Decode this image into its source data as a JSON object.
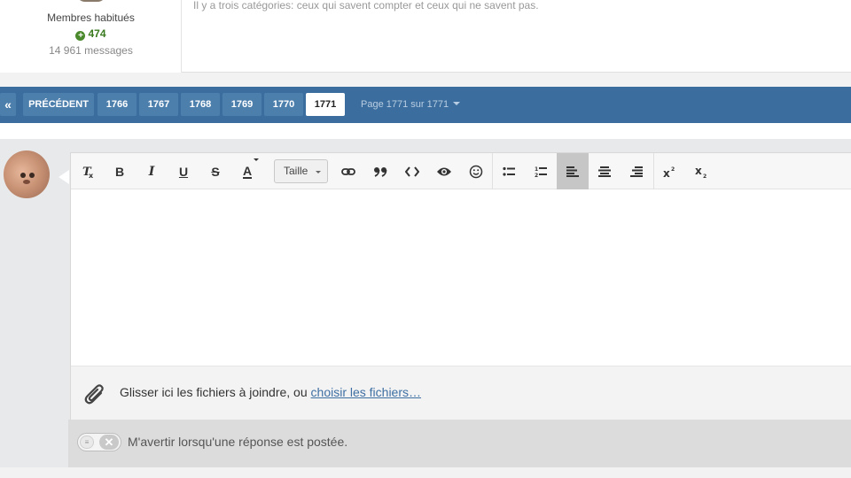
{
  "post": {
    "author_group": "Membres habitués",
    "reputation": "474",
    "messages": "14 961 messages",
    "signature": "Il y a trois catégories: ceux qui savent compter et ceux qui ne savent pas."
  },
  "pagination": {
    "first_icon": "double-chevron-left-icon",
    "first_glyph": "«",
    "prev_label": "PRÉCÉDENT",
    "pages": [
      "1766",
      "1767",
      "1768",
      "1769",
      "1770",
      "1771"
    ],
    "current_page": "1771",
    "page_info": "Page 1771 sur 1771"
  },
  "editor": {
    "toolbar": {
      "clear_format": "remove-format-icon",
      "bold": "B",
      "italic": "I",
      "underline": "U",
      "strike": "S",
      "color": "A",
      "size_label": "Taille",
      "link": "link-icon",
      "quote": "quote-icon",
      "code": "code-icon",
      "preview": "eye-icon",
      "emoji": "smiley-icon",
      "bullet_list": "bulleted-list-icon",
      "numbered_list": "numbered-list-icon",
      "align_left": "align-left-icon",
      "align_center": "align-center-icon",
      "align_right": "align-right-icon",
      "superscript": "superscript-icon",
      "subscript": "subscript-icon"
    },
    "attach_text": "Glisser ici les fichiers à joindre, ou ",
    "attach_link": "choisir les fichiers…"
  },
  "notify": {
    "label": "M'avertir lorsqu'une réponse est postée.",
    "enabled": false
  },
  "colors": {
    "pager_bg": "#3b6e9e",
    "pager_item": "#4d7fad",
    "link": "#3e6fa3",
    "reputation_green": "#4b8a2c"
  }
}
